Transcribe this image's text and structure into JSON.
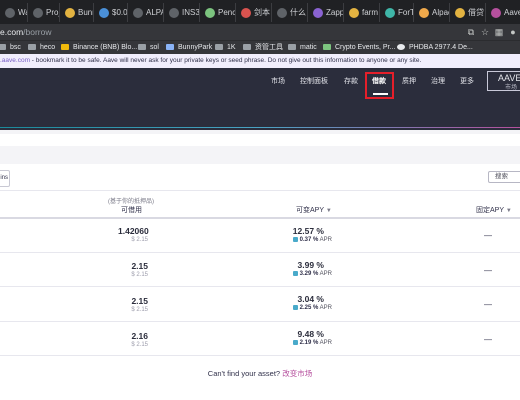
{
  "browser": {
    "tabs": [
      {
        "label": "Waul"
      },
      {
        "label": "Proje"
      },
      {
        "label": "Bunn"
      },
      {
        "label": "$0.0"
      },
      {
        "label": "ALPA"
      },
      {
        "label": "INS3"
      },
      {
        "label": "Penc"
      },
      {
        "label": "剑本"
      },
      {
        "label": "什么"
      },
      {
        "label": "Zapp"
      },
      {
        "label": "farm"
      },
      {
        "label": "ForTu"
      },
      {
        "label": "Alpac"
      },
      {
        "label": "借贷"
      },
      {
        "label": "Aave"
      }
    ],
    "url_domain": "e.com",
    "url_path": "/borrow",
    "bookmarks": [
      {
        "label": "bsc",
        "icon": "folder-icon"
      },
      {
        "label": "heco",
        "icon": "folder-icon"
      },
      {
        "label": "Binance (BNB) Blo...",
        "icon": "binance-icon"
      },
      {
        "label": "sol",
        "icon": "folder-icon"
      },
      {
        "label": "BunnyPark",
        "icon": "bunnypark-icon"
      },
      {
        "label": "1K",
        "icon": "folder-icon"
      },
      {
        "label": "资管工具",
        "icon": "folder-icon"
      },
      {
        "label": "matic",
        "icon": "folder-icon"
      },
      {
        "label": "Crypto Events, Pr...",
        "icon": "crypto-icon"
      },
      {
        "label": "PHDBA 2977.4 De...",
        "icon": "github-icon"
      }
    ]
  },
  "notice": {
    "link": ".aave.com",
    "text": " - bookmark it to be safe. Aave will never ask for your private keys or seed phrase. Do not give out this information to anyone or any site."
  },
  "nav": {
    "items": [
      {
        "label": "市场",
        "active": false
      },
      {
        "label": "控制面板",
        "active": false
      },
      {
        "label": "存款",
        "active": false
      },
      {
        "label": "借款",
        "active": true
      },
      {
        "label": "质押",
        "active": false
      },
      {
        "label": "治理",
        "active": false
      },
      {
        "label": "更多",
        "active": false
      }
    ],
    "logo_text": "AAVE",
    "logo_sub": "市场"
  },
  "toolbar": {
    "left_button": "ins",
    "search_placeholder": "搜索"
  },
  "table": {
    "hint": "(基于你的抵押品)",
    "col_available": "可借用",
    "col_variable": "可变APY",
    "col_stable": "固定APY",
    "sort_glyph": "▼",
    "rows": [
      {
        "available": "1.42060",
        "available_usd": "$ 2.15",
        "apy": "12.57 %",
        "incentive": "0.37 %",
        "incentive_unit": "APR",
        "stable": "—"
      },
      {
        "available": "2.15",
        "available_usd": "$ 2.15",
        "apy": "3.99 %",
        "incentive": "3.29 %",
        "incentive_unit": "APR",
        "stable": "—"
      },
      {
        "available": "2.15",
        "available_usd": "$ 2.15",
        "apy": "3.04 %",
        "incentive": "2.25 %",
        "incentive_unit": "APR",
        "stable": "—"
      },
      {
        "available": "2.16",
        "available_usd": "$ 2.15",
        "apy": "9.48 %",
        "incentive": "2.19 %",
        "incentive_unit": "APR",
        "stable": "—"
      }
    ]
  },
  "footer": {
    "text": "Can't find your asset?",
    "link": "改变市场"
  }
}
